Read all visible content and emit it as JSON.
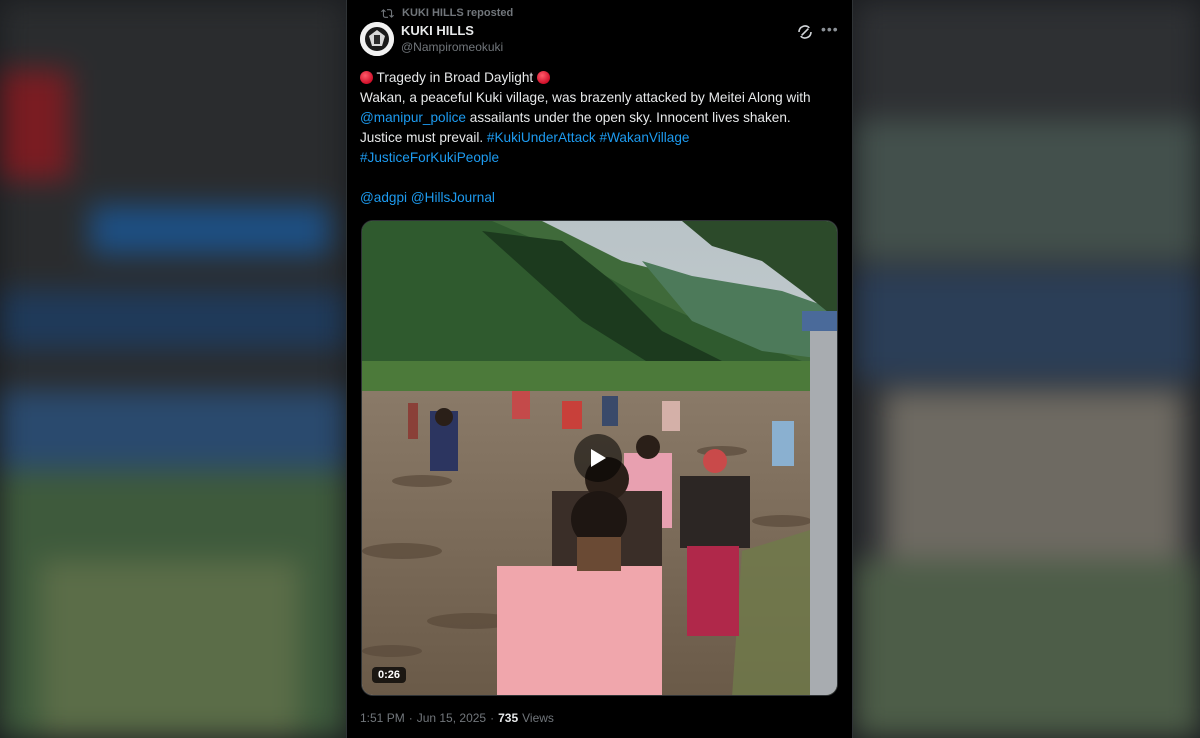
{
  "repost": {
    "text": "KUKI HILLS reposted"
  },
  "author": {
    "name": "KUKI HILLS",
    "handle": "@Nampiromeokuki"
  },
  "tweet": {
    "title": "Tragedy in Broad Daylight",
    "line1": "Wakan, a peaceful Kuki village, was brazenly attacked by Meitei Along with",
    "mention_police": "@manipur_police",
    "line2": "assailants under the open sky. Innocent lives shaken. Justice must prevail.",
    "hashtag1": "#KukiUnderAttack",
    "hashtag2": "#WakanVillage",
    "hashtag3": "#JusticeForKukiPeople",
    "mention1": "@adgpi",
    "mention2": "@HillsJournal"
  },
  "video": {
    "duration": "0:26"
  },
  "meta": {
    "time": "1:51 PM",
    "sep": "·",
    "date": "Jun 15, 2025",
    "views": "735",
    "views_label": "Views"
  },
  "icons": {
    "repost": "repost-icon",
    "grok": "grok-icon",
    "more": "more-icon",
    "play": "play-icon",
    "title_emoji": "red-circle-icon"
  },
  "colors": {
    "link": "#1d9bf0",
    "background": "#000000",
    "muted": "#71767b"
  }
}
